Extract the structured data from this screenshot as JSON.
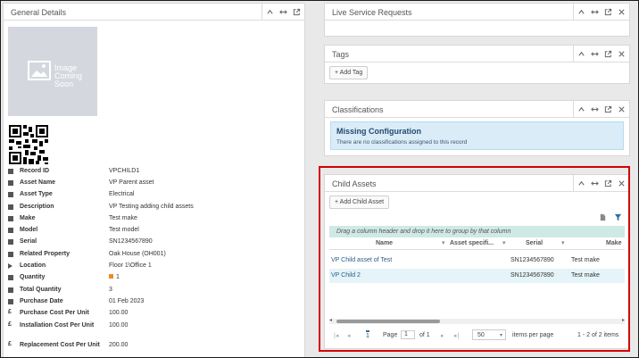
{
  "general": {
    "title": "General Details",
    "image_placeholder": [
      "Image",
      "Coming",
      "Soon"
    ],
    "rows": [
      {
        "label": "Record ID",
        "value": "VPCHILD1",
        "icon": "barcode-icon"
      },
      {
        "label": "Asset Name",
        "value": "VP Parent asset",
        "icon": "document-icon"
      },
      {
        "label": "Asset Type",
        "value": "Electrical",
        "icon": "document-icon"
      },
      {
        "label": "Description",
        "value": "VP Testing adding child assets",
        "icon": "document-icon"
      },
      {
        "label": "Make",
        "value": "Test make",
        "icon": "document-icon"
      },
      {
        "label": "Model",
        "value": "Test model",
        "icon": "document-icon"
      },
      {
        "label": "Serial",
        "value": "SN1234567890",
        "icon": "barcode-icon"
      },
      {
        "label": "Related Property",
        "value": "Oak House (OH001)",
        "icon": "building-icon",
        "link": true
      },
      {
        "label": "Location",
        "value": "Floor 1\\Office 1",
        "icon": "location-arrow-icon"
      },
      {
        "label": "Quantity",
        "value": "1",
        "icon": "truck-icon",
        "badge": true
      },
      {
        "label": "Total Quantity",
        "value": "3",
        "icon": "truck-icon"
      },
      {
        "label": "Purchase Date",
        "value": "01 Feb 2023",
        "icon": "calendar-icon"
      },
      {
        "label": "Purchase Cost Per Unit",
        "value": "100.00",
        "icon": "pound-icon"
      },
      {
        "label": "Installation Cost Per Unit",
        "value": "100.00",
        "icon": "pound-icon"
      },
      {
        "label": "Replacement Cost Per Unit",
        "value": "200.00",
        "icon": "pound-icon"
      }
    ]
  },
  "live": {
    "title": "Live Service Requests"
  },
  "tags": {
    "title": "Tags",
    "add_label": "+ Add Tag"
  },
  "classifications": {
    "title": "Classifications",
    "missing_title": "Missing Configuration",
    "missing_text": "There are no classifications assigned to this record"
  },
  "child_assets": {
    "title": "Child Assets",
    "add_label": "+ Add Child Asset",
    "group_hint": "Drag a column header and drop it here to group by that column",
    "columns": [
      "Name",
      "Asset specifi...",
      "Serial",
      "Make"
    ],
    "rows": [
      {
        "name": "VP Child asset of Test",
        "spec": "",
        "serial": "SN1234567890",
        "make": "Test make"
      },
      {
        "name": "VP Child 2",
        "spec": "",
        "serial": "SN1234567890",
        "make": "Test make"
      }
    ],
    "pager": {
      "current_page": "1",
      "page_label": "Page",
      "page_input": "1",
      "of_label": "of 1",
      "page_size": "50",
      "items_per_page": "items per page",
      "summary": "1 - 2 of 2 items"
    }
  },
  "colors": {
    "accent": "#2b5b8a",
    "highlight": "#d40000",
    "info_bg": "#d9ecf8",
    "row_selected": "#e5f4f8",
    "quantity_badge": "#f08a24"
  }
}
